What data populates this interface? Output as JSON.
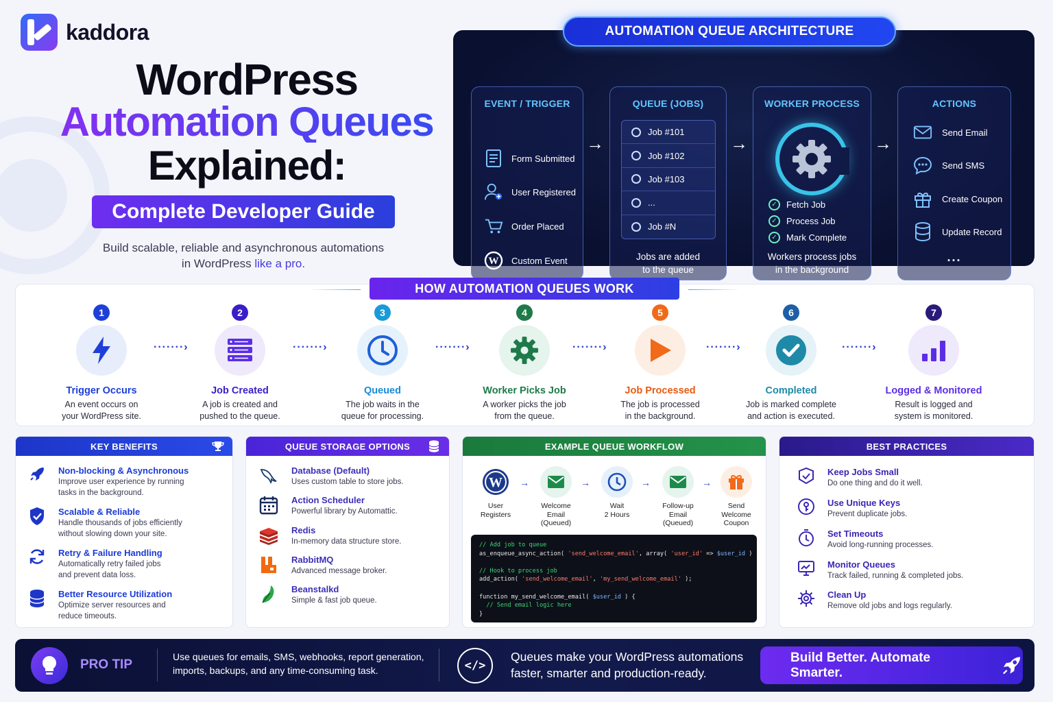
{
  "brand": {
    "name": "kaddora"
  },
  "hero": {
    "line1": "WordPress",
    "line2": "Automation Queues",
    "line3": "Explained:",
    "pill": "Complete Developer Guide",
    "sub_a": "Build scalable, reliable and asynchronous automations",
    "sub_b": "in WordPress",
    "sub_c": "like a pro."
  },
  "architecture": {
    "title": "AUTOMATION QUEUE ARCHITECTURE",
    "event": {
      "heading": "EVENT / TRIGGER",
      "items": [
        "Form Submitted",
        "User Registered",
        "Order Placed",
        "Custom Event"
      ]
    },
    "queue": {
      "heading": "QUEUE (JOBS)",
      "jobs": [
        "Job #101",
        "Job #102",
        "Job #103",
        "...",
        "Job #N"
      ],
      "foot_a": "Jobs are added",
      "foot_b": "to the queue"
    },
    "worker": {
      "heading": "WORKER PROCESS",
      "steps": [
        "Fetch Job",
        "Process Job",
        "Mark Complete"
      ],
      "foot_a": "Workers process jobs",
      "foot_b": "in the background"
    },
    "actions": {
      "heading": "ACTIONS",
      "items": [
        "Send Email",
        "Send SMS",
        "Create Coupon",
        "Update Record"
      ],
      "more": "..."
    }
  },
  "how": {
    "title": "HOW AUTOMATION QUEUES WORK",
    "steps": [
      {
        "num": "1",
        "title": "Trigger Occurs",
        "d1": "An event occurs on",
        "d2": "your WordPress site."
      },
      {
        "num": "2",
        "title": "Job Created",
        "d1": "A job is created and",
        "d2": "pushed to the queue."
      },
      {
        "num": "3",
        "title": "Queued",
        "d1": "The job waits in the",
        "d2": "queue for processing."
      },
      {
        "num": "4",
        "title": "Worker Picks Job",
        "d1": "A worker picks the job",
        "d2": "from the queue."
      },
      {
        "num": "5",
        "title": "Job Processed",
        "d1": "The job is processed",
        "d2": "in the background."
      },
      {
        "num": "6",
        "title": "Completed",
        "d1": "Job is marked complete",
        "d2": "and action is executed."
      },
      {
        "num": "7",
        "title": "Logged & Monitored",
        "d1": "Result is logged and",
        "d2": "system is monitored."
      }
    ]
  },
  "benefits": {
    "title": "KEY BENEFITS",
    "items": [
      {
        "t": "Non-blocking & Asynchronous",
        "d1": "Improve user experience by running",
        "d2": "tasks in the background."
      },
      {
        "t": "Scalable & Reliable",
        "d1": "Handle thousands of jobs efficiently",
        "d2": "without slowing down your site."
      },
      {
        "t": "Retry & Failure Handling",
        "d1": "Automatically retry failed jobs",
        "d2": "and prevent data loss."
      },
      {
        "t": "Better Resource Utilization",
        "d1": "Optimize server resources and",
        "d2": "reduce timeouts."
      }
    ]
  },
  "storage": {
    "title": "QUEUE STORAGE OPTIONS",
    "items": [
      {
        "t": "Database (Default)",
        "d": "Uses custom table to store jobs."
      },
      {
        "t": "Action Scheduler",
        "d": "Powerful library by Automattic."
      },
      {
        "t": "Redis",
        "d": "In-memory data structure store."
      },
      {
        "t": "RabbitMQ",
        "d": "Advanced message broker."
      },
      {
        "t": "Beanstalkd",
        "d": "Simple & fast job queue."
      }
    ]
  },
  "workflow": {
    "title": "EXAMPLE QUEUE WORKFLOW",
    "nodes": [
      {
        "a": "User",
        "b": "Registers",
        "c": ""
      },
      {
        "a": "Welcome",
        "b": "Email",
        "c": "(Queued)"
      },
      {
        "a": "Wait",
        "b": "2 Hours",
        "c": ""
      },
      {
        "a": "Follow-up",
        "b": "Email",
        "c": "(Queued)"
      },
      {
        "a": "Send",
        "b": "Welcome",
        "c": "Coupon"
      }
    ],
    "code": {
      "c1": "// Add job to queue",
      "l2a": "as_enqueue_async_action( ",
      "l2b": "'send_welcome_email'",
      "l2c": ", array( ",
      "l2d": "'user_id'",
      "l2e": " => ",
      "l2f": "$user_id",
      "l2g": " ) );",
      "c3": "// Hook to process job",
      "l4a": "add_action( ",
      "l4b": "'send_welcome_email'",
      "l4c": ", ",
      "l4d": "'my_send_welcome_email'",
      "l4e": " );",
      "l5a": "function my_send_welcome_email( ",
      "l5b": "$user_id",
      "l5c": " ) {",
      "c6": "  // Send email logic here",
      "l7": "}"
    }
  },
  "practices": {
    "title": "BEST PRACTICES",
    "items": [
      {
        "t": "Keep Jobs Small",
        "d": "Do one thing and do it well."
      },
      {
        "t": "Use Unique Keys",
        "d": "Prevent duplicate jobs."
      },
      {
        "t": "Set Timeouts",
        "d": "Avoid long-running processes."
      },
      {
        "t": "Monitor Queues",
        "d": "Track failed, running & completed jobs."
      },
      {
        "t": "Clean Up",
        "d": "Remove old jobs and logs regularly."
      }
    ]
  },
  "footer": {
    "protip": "PRO TIP",
    "tip_a": "Use queues for emails, SMS, webhooks, report generation,",
    "tip_b": "imports, backups, and any time-consuming task.",
    "code_icon": "</>",
    "msg_a": "Queues make your WordPress automations",
    "msg_b": "faster, smarter and production-ready.",
    "cta": "Build Better. Automate Smarter."
  },
  "colors": {
    "primary_blue": "#2d3fe2",
    "purple": "#6a24ec",
    "green": "#1e8a4a",
    "orange": "#f06a1a",
    "dark_panel": "#0a1030"
  }
}
